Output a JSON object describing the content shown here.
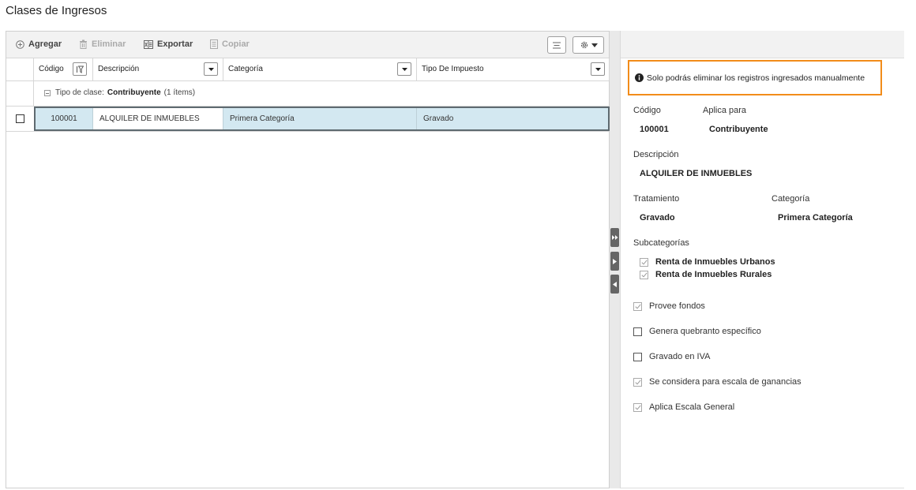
{
  "page": {
    "title": "Clases de Ingresos"
  },
  "toolbar": {
    "add_label": "Agregar",
    "delete_label": "Eliminar",
    "export_label": "Exportar",
    "copy_label": "Copiar"
  },
  "grid": {
    "columns": [
      "Código",
      "Descripción",
      "Categoría",
      "Tipo De Impuesto"
    ],
    "group": {
      "prefix": "Tipo de clase:",
      "value": "Contribuyente",
      "count": "(1 ítems)"
    },
    "rows": [
      {
        "codigo": "100001",
        "descripcion": "ALQUILER DE INMUEBLES",
        "categoria": "Primera Categoría",
        "tipo_impuesto": "Gravado"
      }
    ]
  },
  "detail": {
    "notice": "Solo podrás eliminar los registros ingresados manualmente",
    "codigo_label": "Código",
    "codigo_value": "100001",
    "aplica_label": "Aplica para",
    "aplica_value": "Contribuyente",
    "descripcion_label": "Descripción",
    "descripcion_value": "ALQUILER DE INMUEBLES",
    "tratamiento_label": "Tratamiento",
    "tratamiento_value": "Gravado",
    "categoria_label": "Categoría",
    "categoria_value": "Primera Categoría",
    "subcategorias_label": "Subcategorías",
    "subcategorias": [
      {
        "label": "Renta de Inmuebles Urbanos",
        "checked": true
      },
      {
        "label": "Renta de Inmuebles Rurales",
        "checked": true
      }
    ],
    "options": [
      {
        "label": "Provee fondos",
        "checked": true
      },
      {
        "label": "Genera quebranto específico",
        "checked": false
      },
      {
        "label": "Gravado en IVA",
        "checked": false
      },
      {
        "label": "Se considera para escala de ganancias",
        "checked": true
      },
      {
        "label": "Aplica Escala General",
        "checked": true
      }
    ]
  },
  "colors": {
    "accent_border": "#f28c1a",
    "selected_row": "#d3e8f1"
  }
}
